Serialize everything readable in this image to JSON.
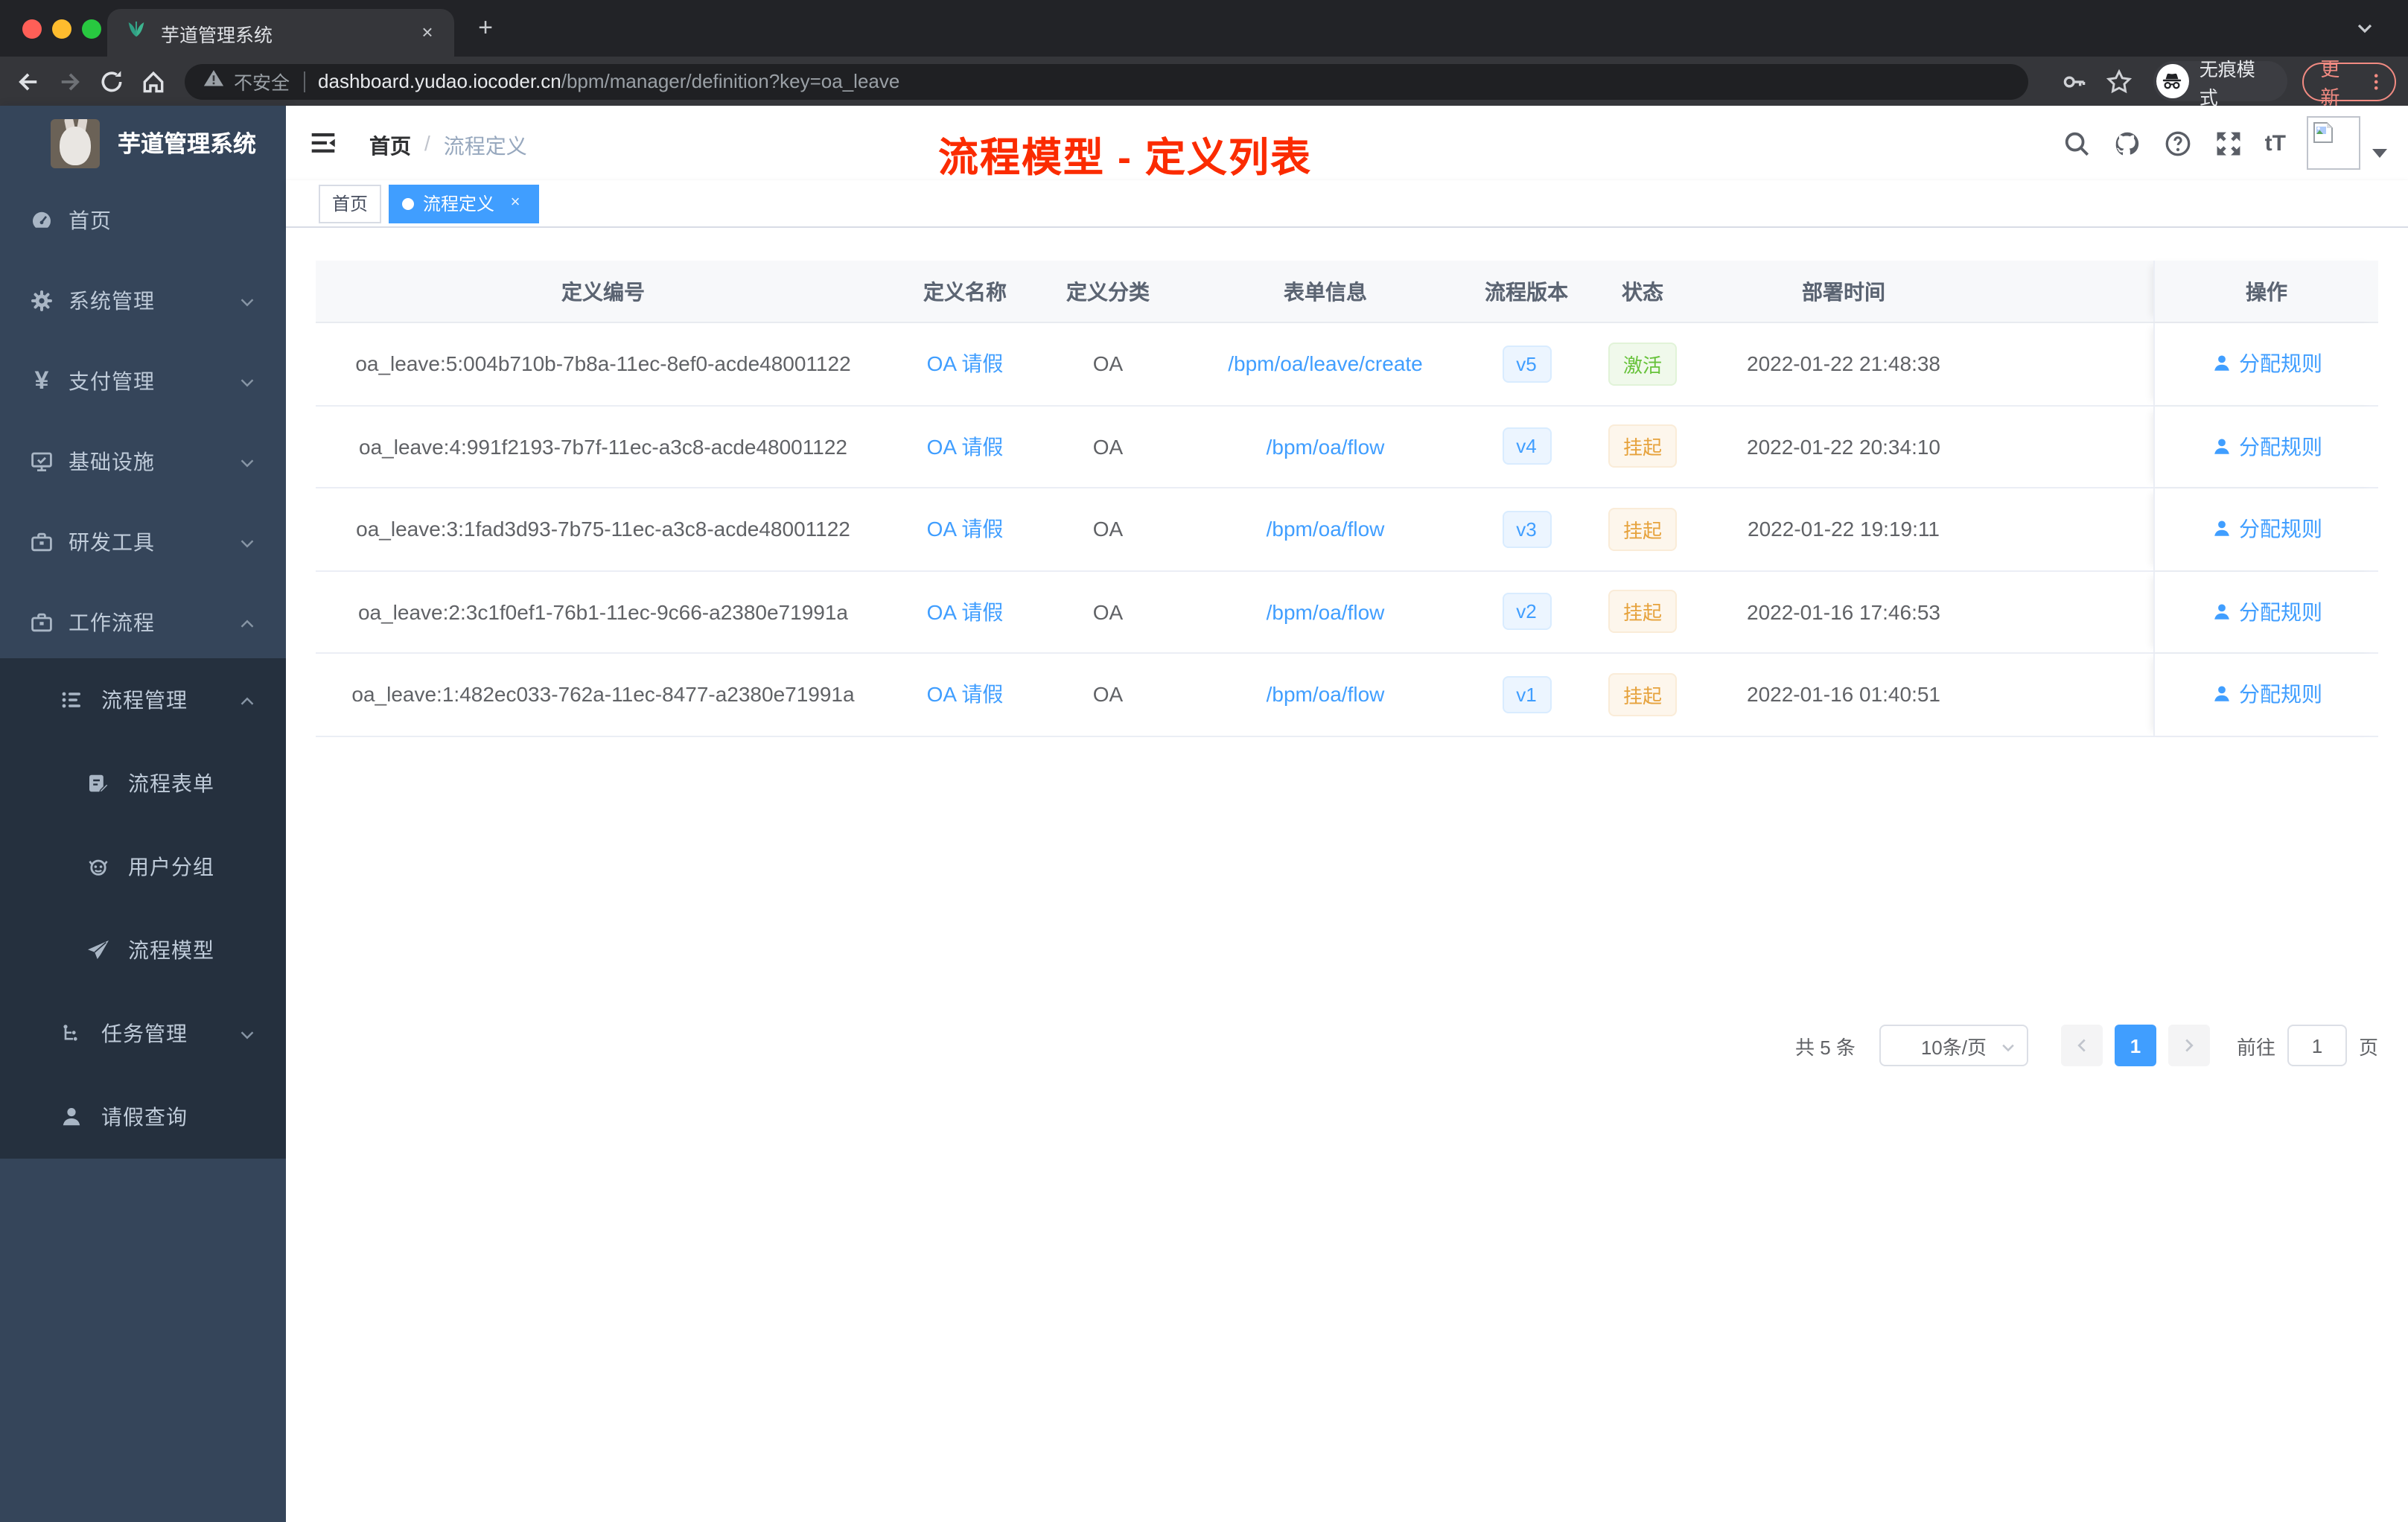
{
  "browser": {
    "tab_title": "芋道管理系统",
    "close_glyph": "×",
    "new_tab_glyph": "+",
    "url_security": "不安全",
    "url_host": "dashboard.yudao.iocoder.cn",
    "url_path": "/bpm/manager/definition?key=oa_leave",
    "incognito_label": "无痕模式",
    "update_label": "更新"
  },
  "sidebar": {
    "logo_text": "芋道管理系统",
    "pay_icon_glyph": "¥",
    "top_items": [
      {
        "label": "首页"
      },
      {
        "label": "系统管理"
      },
      {
        "label": "支付管理"
      },
      {
        "label": "基础设施"
      },
      {
        "label": "研发工具"
      },
      {
        "label": "工作流程"
      }
    ],
    "workflow_children": [
      {
        "label": "流程管理"
      },
      {
        "label": "流程表单"
      },
      {
        "label": "用户分组"
      },
      {
        "label": "流程模型"
      },
      {
        "label": "任务管理"
      },
      {
        "label": "请假查询"
      }
    ]
  },
  "header": {
    "breadcrumb_home": "首页",
    "breadcrumb_sep": "/",
    "breadcrumb_current": "流程定义",
    "overlay_title": "流程模型 - 定义列表",
    "font_size_icon_text": "tT"
  },
  "tags": {
    "home": "首页",
    "current": "流程定义",
    "close_glyph": "×"
  },
  "table": {
    "columns": [
      "定义编号",
      "定义名称",
      "定义分类",
      "表单信息",
      "流程版本",
      "状态",
      "部署时间",
      "操作"
    ],
    "rows": [
      {
        "id": "oa_leave:5:004b710b-7b8a-11ec-8ef0-acde48001122",
        "name": "OA 请假",
        "category": "OA",
        "form": "/bpm/oa/leave/create",
        "version": "v5",
        "status": "激活",
        "status_type": "success",
        "time": "2022-01-22 21:48:38",
        "action": "分配规则"
      },
      {
        "id": "oa_leave:4:991f2193-7b7f-11ec-a3c8-acde48001122",
        "name": "OA 请假",
        "category": "OA",
        "form": "/bpm/oa/flow",
        "version": "v4",
        "status": "挂起",
        "status_type": "warning",
        "time": "2022-01-22 20:34:10",
        "action": "分配规则"
      },
      {
        "id": "oa_leave:3:1fad3d93-7b75-11ec-a3c8-acde48001122",
        "name": "OA 请假",
        "category": "OA",
        "form": "/bpm/oa/flow",
        "version": "v3",
        "status": "挂起",
        "status_type": "warning",
        "time": "2022-01-22 19:19:11",
        "action": "分配规则"
      },
      {
        "id": "oa_leave:2:3c1f0ef1-76b1-11ec-9c66-a2380e71991a",
        "name": "OA 请假",
        "category": "OA",
        "form": "/bpm/oa/flow",
        "version": "v2",
        "status": "挂起",
        "status_type": "warning",
        "time": "2022-01-16 17:46:53",
        "action": "分配规则"
      },
      {
        "id": "oa_leave:1:482ec033-762a-11ec-8477-a2380e71991a",
        "name": "OA 请假",
        "category": "OA",
        "form": "/bpm/oa/flow",
        "version": "v1",
        "status": "挂起",
        "status_type": "warning",
        "time": "2022-01-16 01:40:51",
        "action": "分配规则"
      }
    ]
  },
  "pagination": {
    "total": "共 5 条",
    "page_size": "10条/页",
    "current_page": "1",
    "goto_label": "前往",
    "goto_value": "1",
    "goto_suffix": "页"
  },
  "colors": {
    "primary": "#409eff",
    "success": "#67c23a",
    "warning": "#e6a23c",
    "title_red": "#fb2b00",
    "sidebar_bg": "#35455a",
    "sidebar_sub_bg": "#25303e"
  }
}
